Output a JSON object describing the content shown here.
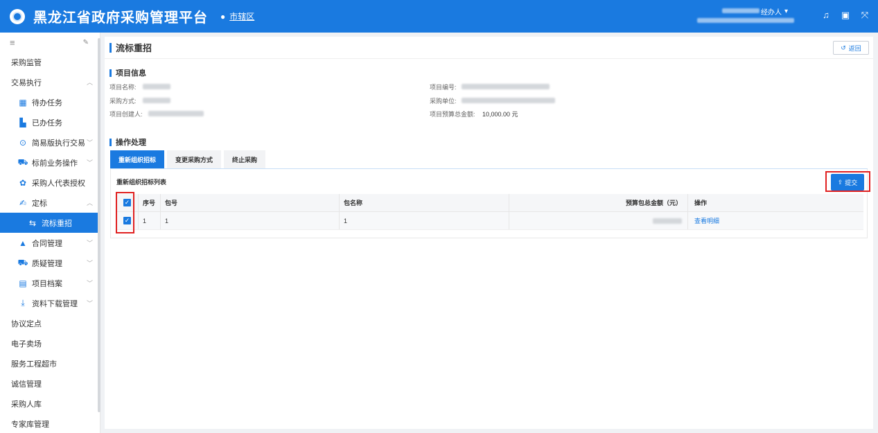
{
  "header": {
    "title": "黑龙江省政府采购管理平台",
    "region": "市辖区",
    "user_role": "经办人"
  },
  "sidebar": {
    "items": [
      {
        "label": "采购监管"
      },
      {
        "label": "交易执行"
      },
      {
        "label": "待办任务"
      },
      {
        "label": "已办任务"
      },
      {
        "label": "简易版执行交易"
      },
      {
        "label": "标前业务操作"
      },
      {
        "label": "采购人代表授权"
      },
      {
        "label": "定标"
      },
      {
        "label": "流标重招"
      },
      {
        "label": "合同管理"
      },
      {
        "label": "质疑管理"
      },
      {
        "label": "项目档案"
      },
      {
        "label": "资料下载管理"
      },
      {
        "label": "协议定点"
      },
      {
        "label": "电子卖场"
      },
      {
        "label": "服务工程超市"
      },
      {
        "label": "诚信管理"
      },
      {
        "label": "采购人库"
      },
      {
        "label": "专家库管理"
      }
    ]
  },
  "page": {
    "title": "流标重招",
    "back_label": "返回"
  },
  "project_info": {
    "section_title": "项目信息",
    "name_label": "项目名称:",
    "method_label": "采购方式:",
    "creator_label": "项目创建人:",
    "code_label": "项目编号:",
    "unit_label": "采购单位:",
    "budget_label": "项目预算总金额:",
    "budget_value": "10,000.00 元"
  },
  "operation": {
    "section_title": "操作处理",
    "tabs": [
      {
        "label": "重新组织招标"
      },
      {
        "label": "变更采购方式"
      },
      {
        "label": "终止采购"
      }
    ],
    "list_title": "重新组织招标列表",
    "submit_label": "提交",
    "table": {
      "headers": {
        "seq": "序号",
        "pkg": "包号",
        "name": "包名称",
        "amount": "预算包总金额（元）",
        "op": "操作"
      },
      "rows": [
        {
          "seq": "1",
          "pkg": "1",
          "name": "1",
          "op": "查看明细"
        }
      ]
    }
  },
  "colors": {
    "brand": "#1a7ae0",
    "highlight": "#e02020"
  }
}
